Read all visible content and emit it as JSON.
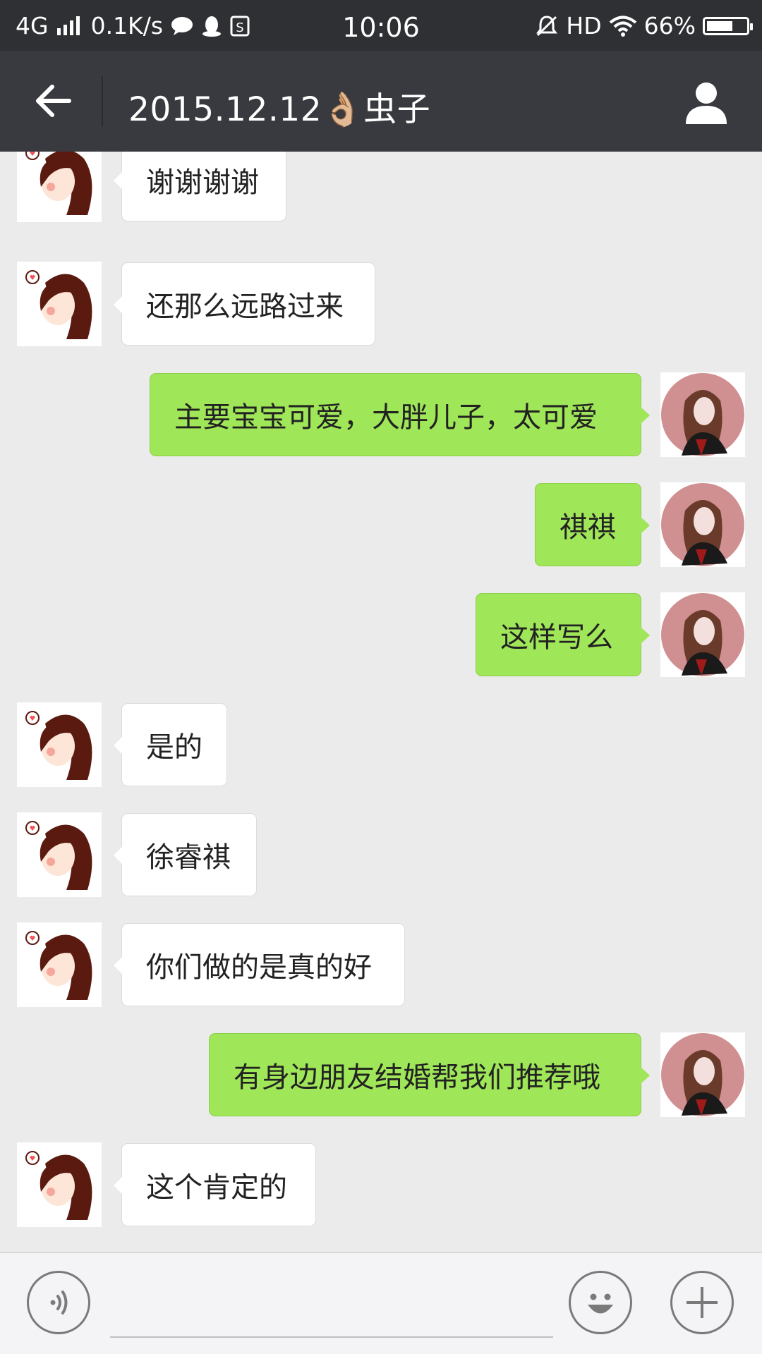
{
  "status_bar": {
    "network": "4G",
    "speed": "0.1K/s",
    "time": "10:06",
    "hd": "HD",
    "battery": "66%",
    "battery_level": 0.66
  },
  "header": {
    "title": "2015.12.12👌🏼虫子"
  },
  "messages": [
    {
      "side": "in",
      "text": "谢谢谢谢"
    },
    {
      "side": "in",
      "text": "还那么远路过来"
    },
    {
      "side": "out",
      "text": "主要宝宝可爱，大胖儿子，太可爱"
    },
    {
      "side": "out",
      "text": "祺祺"
    },
    {
      "side": "out",
      "text": "这样写么"
    },
    {
      "side": "in",
      "text": "是的"
    },
    {
      "side": "in",
      "text": "徐睿祺"
    },
    {
      "side": "in",
      "text": "你们做的是真的好"
    },
    {
      "side": "out",
      "text": "有身边朋友结婚帮我们推荐哦"
    },
    {
      "side": "in",
      "text": "这个肯定的"
    }
  ],
  "input": {
    "value": "",
    "placeholder": ""
  },
  "colors": {
    "bubble_out": "#9fe658",
    "bubble_in": "#ffffff",
    "header_bg": "#393a3f",
    "status_bg": "#2e3033",
    "chat_bg": "#ebebeb"
  }
}
